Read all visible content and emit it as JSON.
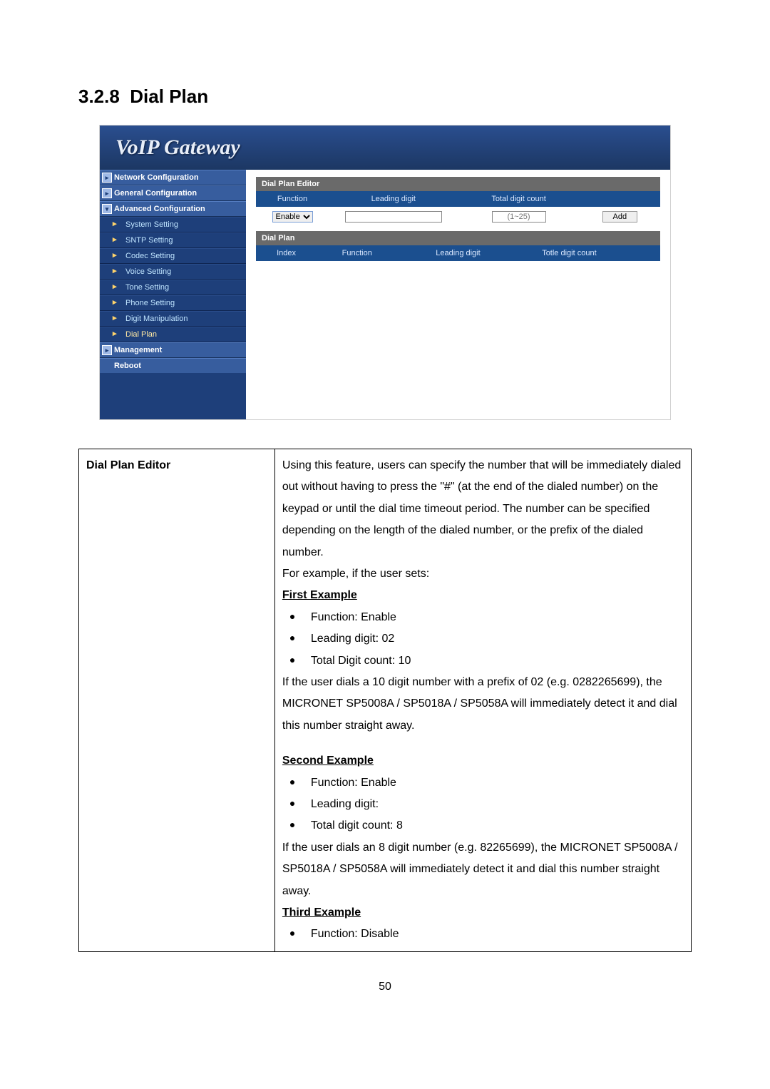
{
  "doc": {
    "section_number": "3.2.8",
    "section_title": "Dial Plan",
    "page_number": "50"
  },
  "screenshot": {
    "app_title": "VoIP  Gateway",
    "sidebar": {
      "groups": [
        {
          "label": "Network Configuration"
        },
        {
          "label": "General Configuration"
        },
        {
          "label": "Advanced Configuration",
          "items": [
            "System Setting",
            "SNTP Setting",
            "Codec Setting",
            "Voice Setting",
            "Tone Setting",
            "Phone Setting",
            "Digit Manipulation",
            "Dial Plan"
          ]
        },
        {
          "label": "Management"
        }
      ],
      "footer_item": "Reboot"
    },
    "editor": {
      "header1": "Dial Plan Editor",
      "cols1": [
        "Function",
        "Leading digit",
        "Total digit count"
      ],
      "function_value": "Enable",
      "leading_digit_value": "",
      "total_digit_hint": "(1~25)",
      "add_label": "Add",
      "header2": "Dial Plan",
      "cols2": [
        "Index",
        "Function",
        "Leading digit",
        "Totle digit count"
      ]
    }
  },
  "table": {
    "left": "Dial Plan Editor",
    "p1": "Using this feature, users can specify the number that will be immediately dialed out without having to press the \"#\" (at the end of the dialed number) on the keypad or until the dial time timeout period.    The number can be specified depending on the length of the dialed number, or the prefix of the dialed number.",
    "p2": "For example, if the user sets:",
    "ex1_head": "First Example",
    "ex1_b1": "Function: Enable",
    "ex1_b2": "Leading digit: 02",
    "ex1_b3": "Total Digit count: 10",
    "ex1_after": "If the user dials a 10 digit number with a prefix of 02 (e.g. 0282265699), the MICRONET SP5008A / SP5018A / SP5058A will immediately detect it and dial this number straight away.",
    "ex2_head": "Second Example",
    "ex2_b1": "Function: Enable",
    "ex2_b2": "Leading digit:",
    "ex2_b3": "Total digit count: 8",
    "ex2_after": "If the user dials an 8 digit number (e.g. 82265699), the MICRONET SP5008A / SP5018A / SP5058A will immediately detect it and dial this number straight away.",
    "ex3_head": "Third Example",
    "ex3_b1": "Function: Disable"
  }
}
